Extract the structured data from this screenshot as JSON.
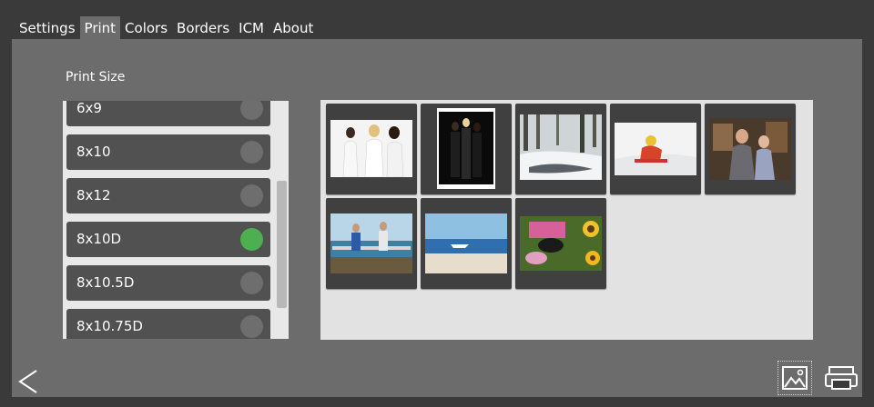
{
  "tabs": [
    {
      "label": "Settings",
      "active": false
    },
    {
      "label": "Print",
      "active": true
    },
    {
      "label": "Colors",
      "active": false
    },
    {
      "label": "Borders",
      "active": false
    },
    {
      "label": "ICM",
      "active": false
    },
    {
      "label": "About",
      "active": false
    }
  ],
  "print_size": {
    "label": "Print Size",
    "items": [
      {
        "label": "6x9",
        "selected": false
      },
      {
        "label": "8x10",
        "selected": false
      },
      {
        "label": "8x12",
        "selected": false
      },
      {
        "label": "8x10D",
        "selected": true
      },
      {
        "label": "8x10.5D",
        "selected": false
      },
      {
        "label": "8x10.75D",
        "selected": false
      }
    ]
  },
  "thumbnails": [
    {
      "subject": "three women on white background"
    },
    {
      "subject": "group portrait on black background"
    },
    {
      "subject": "snowy forest stream"
    },
    {
      "subject": "child sledding in snow"
    },
    {
      "subject": "elderly couple in shop"
    },
    {
      "subject": "people on a boat pier"
    },
    {
      "subject": "beach with boat"
    },
    {
      "subject": "child lying among sunflowers"
    }
  ],
  "icons": {
    "back": "chevron-left-icon",
    "image": "image-icon",
    "print": "printer-icon"
  },
  "colors": {
    "selected_radio": "#4caf50",
    "panel": "#6c6c6c",
    "background": "#3a3a3a"
  }
}
